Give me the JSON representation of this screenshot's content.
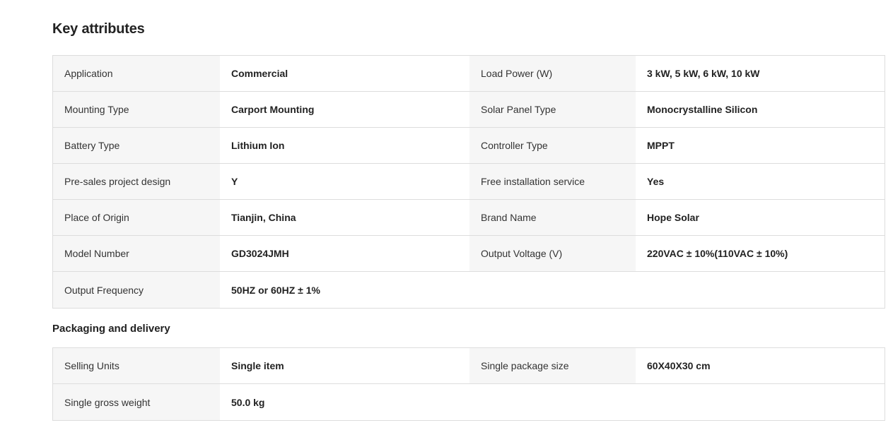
{
  "key_attributes": {
    "title": "Key attributes",
    "rows": [
      [
        {
          "label": "Application",
          "value": "Commercial"
        },
        {
          "label": "Load Power (W)",
          "value": "3 kW, 5 kW, 6 kW, 10 kW"
        }
      ],
      [
        {
          "label": "Mounting Type",
          "value": "Carport Mounting"
        },
        {
          "label": "Solar Panel Type",
          "value": "Monocrystalline Silicon"
        }
      ],
      [
        {
          "label": "Battery Type",
          "value": "Lithium Ion"
        },
        {
          "label": "Controller Type",
          "value": "MPPT"
        }
      ],
      [
        {
          "label": "Pre-sales project design",
          "value": "Y"
        },
        {
          "label": "Free installation service",
          "value": "Yes"
        }
      ],
      [
        {
          "label": "Place of Origin",
          "value": "Tianjin, China"
        },
        {
          "label": "Brand Name",
          "value": "Hope Solar"
        }
      ],
      [
        {
          "label": "Model Number",
          "value": "GD3024JMH"
        },
        {
          "label": "Output Voltage (V)",
          "value": "220VAC ± 10%(110VAC ± 10%)"
        }
      ],
      [
        {
          "label": "Output Frequency",
          "value": "50HZ or 60HZ ± 1%"
        }
      ]
    ]
  },
  "packaging": {
    "title": "Packaging and delivery",
    "rows": [
      [
        {
          "label": "Selling Units",
          "value": "Single item"
        },
        {
          "label": "Single package size",
          "value": "60X40X30 cm"
        }
      ],
      [
        {
          "label": "Single gross weight",
          "value": "50.0 kg"
        }
      ]
    ]
  }
}
